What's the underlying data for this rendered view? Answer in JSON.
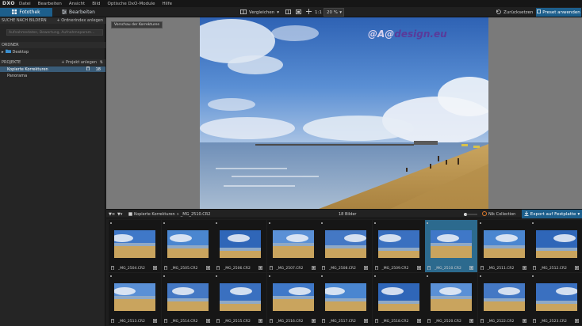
{
  "app": {
    "logo": "DXO"
  },
  "menu": [
    "Datei",
    "Bearbeiten",
    "Ansicht",
    "Bild",
    "Optische DxO-Module",
    "Hilfe"
  ],
  "toolbar": {
    "tab_library": "Fotothek",
    "tab_edit": "Bearbeiten",
    "compare": "Vergleichen",
    "ratio": "1:1",
    "zoom": "20 %",
    "reset": "Zurücksetzen",
    "apply_preset": "Preset anwenden"
  },
  "sidebar": {
    "search_header": "SUCHE NACH BILDERN",
    "search_action": "+ Ordnerindex anlegen",
    "search_placeholder": "Aufnahmedaten, Bewertung, Aufnahmeparam...",
    "folders_header": "ORDNER",
    "folder_desktop": "Desktop",
    "projects_header": "PROJEKTE",
    "projects_action": "+ Projekt anlegen",
    "projects": [
      {
        "label": "Kopierte Korrekturen",
        "count": "18"
      },
      {
        "label": "Panorama",
        "count": ""
      }
    ]
  },
  "viewer": {
    "preview_label": "Vorschau der Korrekturen",
    "watermark_a": "@A@",
    "watermark_b": "design.eu"
  },
  "filmbar": {
    "breadcrumb_project": "Kopierte Korrekturen",
    "breadcrumb_sep": "»",
    "breadcrumb_file": "_MG_2510.CR2",
    "image_count": "18 Bilder",
    "nik": "Nik Collection",
    "export": "Export auf Festplatte"
  },
  "thumbnails": [
    {
      "name": "_MG_2504.CR2",
      "selected": false
    },
    {
      "name": "_MG_2505.CR2",
      "selected": false
    },
    {
      "name": "_MG_2506.CR2",
      "selected": false
    },
    {
      "name": "_MG_2507.CR2",
      "selected": false
    },
    {
      "name": "_MG_2508.CR2",
      "selected": false
    },
    {
      "name": "_MG_2509.CR2",
      "selected": false
    },
    {
      "name": "_MG_2510.CR2",
      "selected": true
    },
    {
      "name": "_MG_2511.CR2",
      "selected": false
    },
    {
      "name": "_MG_2512.CR2",
      "selected": false
    },
    {
      "name": "_MG_2513.CR2",
      "selected": false
    },
    {
      "name": "_MG_2514.CR2",
      "selected": false
    },
    {
      "name": "_MG_2515.CR2",
      "selected": false
    },
    {
      "name": "_MG_2516.CR2",
      "selected": false
    },
    {
      "name": "_MG_2517.CR2",
      "selected": false
    },
    {
      "name": "_MG_2518.CR2",
      "selected": false
    },
    {
      "name": "_MG_2520.CR2",
      "selected": false
    },
    {
      "name": "_MG_2522.CR2",
      "selected": false
    },
    {
      "name": "_MG_2523.CR2",
      "selected": false
    }
  ],
  "colors": {
    "accent": "#1d5f8c",
    "selection": "#2c6a8e",
    "sky": "#3d76c4",
    "sand": "#c9a45e",
    "sea": "#8fa9c6"
  }
}
